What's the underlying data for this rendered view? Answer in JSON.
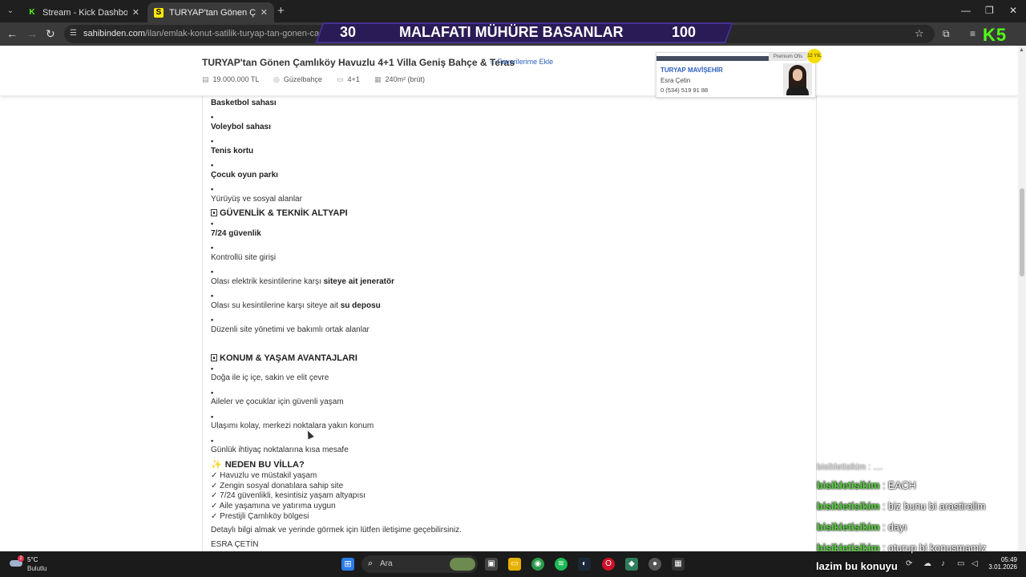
{
  "browser": {
    "tabs": [
      {
        "title": "Stream - Kick Dashboard",
        "favicon": "K"
      },
      {
        "title": "TURYAP'tan Gönen Çamlıköy Ha",
        "favicon": "S"
      }
    ],
    "url_host": "sahibinden.com",
    "url_path": "/ilan/emlak-konut-satilik-turyap-tan-gonen-camlikoy-"
  },
  "overlay": {
    "left_num": "30",
    "banner_title": "MALAFATI MÜHÜRE BASANLAR",
    "right_num": "100",
    "logo": "K5"
  },
  "listing": {
    "title": "TURYAP'tan Gönen Çamlıköy Havuzlu 4+1 Villa Geniş Bahçe & Teras",
    "fav_label": "Favorilerime Ekle",
    "price": "19.000.000 TL",
    "location": "Güzelbahçe",
    "rooms": "4+1",
    "area": "240m² (brüt)"
  },
  "agent": {
    "premium_label": "Premium Ofis",
    "badge": "12 YIL",
    "office": "TURYAP MAVİŞEHİR",
    "name": "Esra Çetin",
    "phone": "0 (534) 519 91 88"
  },
  "description": {
    "l1": "Basketbol sahası",
    "l2": "Voleybol sahası",
    "l3": "Tenis kortu",
    "l4": "Çocuk oyun parkı",
    "l5": "Yürüyüş ve sosyal alanlar",
    "sec1": "GÜVENLİK & TEKNİK ALTYAPI",
    "s1a": "7/24 güvenlik",
    "s1b": "Kontrollü site girişi",
    "s1c_pre": "Olası elektrik kesintilerine karşı ",
    "s1c_bold": "siteye ait jeneratör",
    "s1d_pre": "Olası su kesintilerine karşı siteye ait ",
    "s1d_bold": "su deposu",
    "s1e": "Düzenli site yönetimi ve bakımlı ortak alanlar",
    "sec2": "KONUM & YAŞAM AVANTAJLARI",
    "s2a": "Doğa ile iç içe, sakin ve elit çevre",
    "s2b": "Aileler ve çocuklar için güvenli yaşam",
    "s2c": "Ulaşımı kolay, merkezi noktalara yakın konum",
    "s2d": "Günlük ihtiyaç noktalarına kısa mesafe",
    "sec3": "NEDEN BU VİLLA?",
    "c1": "✓ Havuzlu ve müstakil yaşam",
    "c2": "✓ Zengin sosyal donatılara sahip site",
    "c3": "✓ 7/24 güvenlikli, kesintisiz yaşam altyapısı",
    "c4": "✓ Aile yaşamına ve yatırıma uygun",
    "c5": "✓ Prestijli Çamlıköy bölgesi",
    "contact": "Detaylı bilgi almak ve yerinde görmek için lütfen iletişime geçebilirsiniz.",
    "signature": "ESRA ÇETİN"
  },
  "chat": {
    "faded": "bisikletisikim : ....",
    "messages": [
      {
        "user": "bisikletisikim",
        "text": " : EACH"
      },
      {
        "user": "bisikletisikim",
        "text": " : biz bunu bi arastiralim"
      },
      {
        "user": "bisikletisikim",
        "text": " : dayı"
      },
      {
        "user": "bisikletisikim",
        "text": " : oturup bi konusmamiz"
      }
    ],
    "continuation": "lazim bu konuyu"
  },
  "taskbar": {
    "temp": "5°C",
    "condition": "Bulutlu",
    "weather_badge": "2",
    "search_placeholder": "Ara",
    "time": "05:49",
    "date": "3.01.2026"
  },
  "colors": {
    "kick_green": "#53fc18",
    "sahibinden_yellow": "#ffe800",
    "link_blue": "#2a5fbc",
    "banner_purple": "#2a1a55"
  }
}
